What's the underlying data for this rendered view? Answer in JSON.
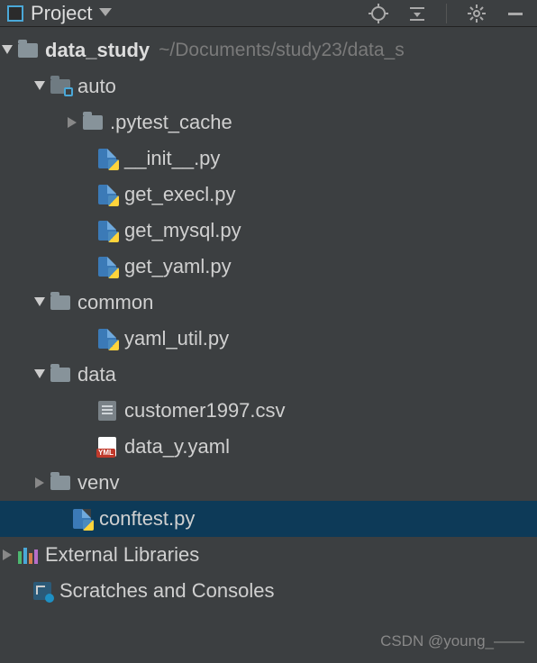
{
  "header": {
    "title": "Project"
  },
  "tree": {
    "root": {
      "name": "data_study",
      "path": "~/Documents/study23/data_s"
    },
    "auto": {
      "name": "auto"
    },
    "pytest_cache": {
      "name": ".pytest_cache"
    },
    "init_py": {
      "name": "__init__.py"
    },
    "get_execl": {
      "name": "get_execl.py"
    },
    "get_mysql": {
      "name": "get_mysql.py"
    },
    "get_yaml": {
      "name": "get_yaml.py"
    },
    "common": {
      "name": "common"
    },
    "yaml_util": {
      "name": "yaml_util.py"
    },
    "data": {
      "name": "data"
    },
    "customer_csv": {
      "name": "customer1997.csv"
    },
    "data_yaml": {
      "name": "data_y.yaml"
    },
    "venv": {
      "name": "venv"
    },
    "conftest": {
      "name": "conftest.py"
    },
    "external": {
      "name": "External Libraries"
    },
    "scratches": {
      "name": "Scratches and Consoles"
    }
  },
  "yaml_badge": "YML",
  "watermark": "CSDN @young_——"
}
